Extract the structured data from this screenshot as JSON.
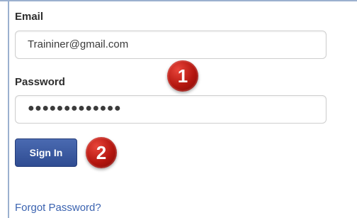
{
  "form": {
    "email_label": "Email",
    "email_value": "Traininer@gmail.com",
    "password_label": "Password",
    "password_value": "●●●●●●●●●●●●●",
    "signin_label": "Sign In",
    "forgot_link": "Forgot Password?"
  },
  "annotations": {
    "step1": "1",
    "step2": "2"
  },
  "colors": {
    "button": "#3a5aa2",
    "badge": "#b3160f",
    "link": "#3b63b0"
  }
}
